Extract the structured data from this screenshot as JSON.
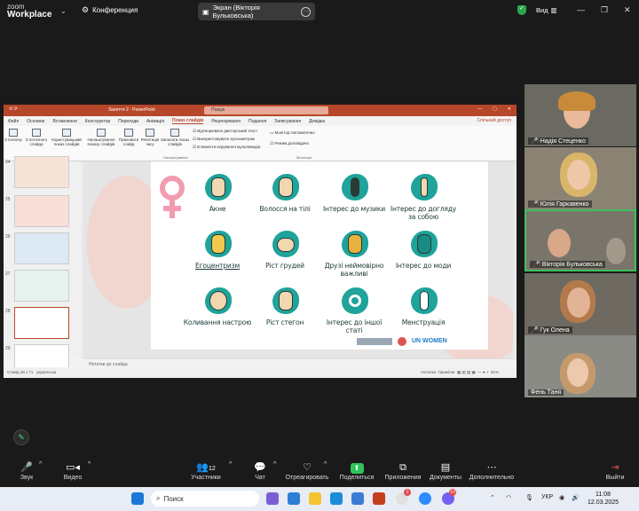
{
  "zoom": {
    "brand_line1": "zoom",
    "brand_line2": "Workplace",
    "conference_label": "Конференция",
    "share_label": "Экран (Вікторія Бульковська)",
    "view_label": "Вид"
  },
  "powerpoint": {
    "title": "Заняття 2 - PowerPoint",
    "search_placeholder": "Пошук",
    "tabs": [
      "Файл",
      "Основне",
      "Вставлення",
      "Конструктор",
      "Переходи",
      "Анімація",
      "Показ слайдів",
      "Рецензування",
      "Подання",
      "Записування",
      "Довідка"
    ],
    "active_tab": "Показ слайдів",
    "share_button": "Спільний доступ",
    "ribbon": {
      "btn_from_start": "З початку",
      "btn_from_current": "З поточного слайда",
      "btn_custom": "Користувацький показ слайдів",
      "btn_setup": "Налаштування показу слайдів",
      "btn_hide": "Приховати слайд",
      "btn_rehearse": "Репетиція часу",
      "btn_record": "Записати показ слайдів",
      "chk_narrations": "Відтворювати дикторський текст",
      "chk_timings": "Використовувати хронометраж",
      "chk_media": "Елементи керування мультимедіа",
      "monitor_label": "Монітор:",
      "monitor_value": "Автоматично",
      "presenter_view": "Режим доповідача",
      "group_start": "Почати показ слайдів",
      "group_setup": "Налаштування",
      "group_monitors": "Монітори"
    },
    "thumb_numbers": [
      "24",
      "25",
      "26",
      "27",
      "28",
      "29"
    ],
    "slide_items": [
      {
        "label": "Акне"
      },
      {
        "label": "Волосся на тілі"
      },
      {
        "label": "Інтерес до музики"
      },
      {
        "label": "Інтерес до догляду за собою"
      },
      {
        "label": "Егоцентризм"
      },
      {
        "label": "Ріст грудей"
      },
      {
        "label": "Друзі неймовірно важливі"
      },
      {
        "label": "Інтерес до моди"
      },
      {
        "label": "Коливання настрою"
      },
      {
        "label": "Ріст стегон"
      },
      {
        "label": "Інтерес до іншої статі"
      },
      {
        "label": "Менструація"
      }
    ],
    "logo_unw": "UN WOMEN",
    "notes_placeholder": "Нотатки до слайда",
    "status_slide": "Слайд 28 з 71",
    "status_lang": "українська",
    "status_notes": "Нотатки",
    "status_comments": "Примітки",
    "zoom_level": "51%"
  },
  "participants": [
    {
      "name": "Надія Стеценко",
      "muted": true
    },
    {
      "name": "Юлія Гаркавенко",
      "muted": true
    },
    {
      "name": "Вікторія Бульковська",
      "muted": true
    },
    {
      "name": "Гук Олена",
      "muted": true
    },
    {
      "name": "Фень Таня",
      "muted": false
    }
  ],
  "toolbar": {
    "audio": "Звук",
    "video": "Видео",
    "participants": "Участники",
    "participants_count": "12",
    "chat": "Чат",
    "react": "Отреагировать",
    "share": "Поделиться",
    "apps": "Приложения",
    "docs": "Документы",
    "more": "Дополнительно",
    "leave": "Выйти"
  },
  "taskbar": {
    "search_placeholder": "Поиск",
    "lang": "УКР",
    "time": "11:08",
    "date": "12.03.2025",
    "badge_1": "2",
    "badge_2": "10"
  }
}
